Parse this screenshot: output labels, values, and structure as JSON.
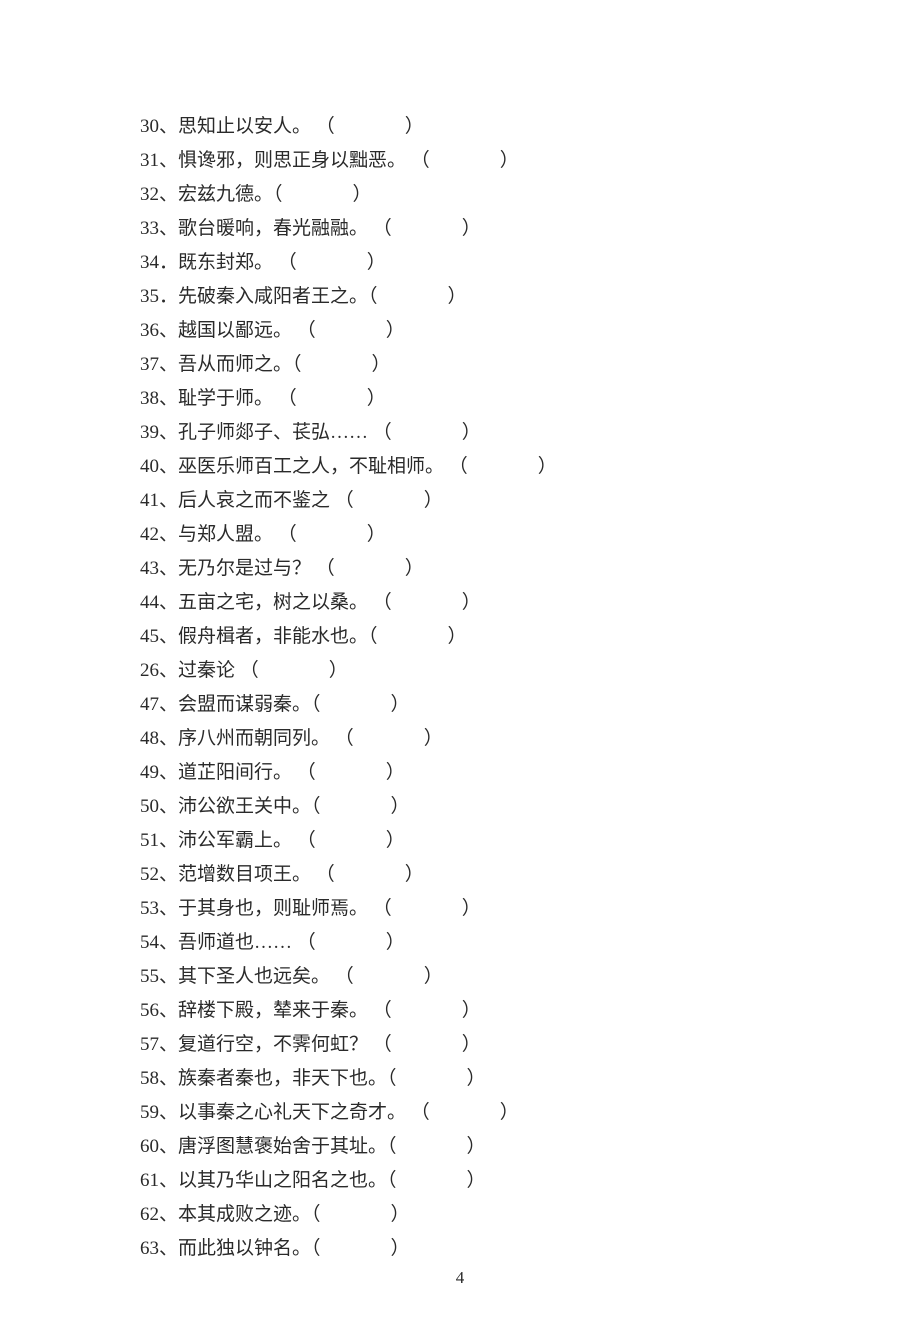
{
  "page_number": "4",
  "blank": "　　　",
  "items": [
    {
      "num": "30",
      "sep": "、",
      "text": "思知止以安人。",
      "pad": " "
    },
    {
      "num": "31",
      "sep": "、",
      "text": "惧谗邪，则思正身以黜恶。",
      "pad": " "
    },
    {
      "num": "32",
      "sep": "、",
      "text": "宏兹九德。",
      "pad": ""
    },
    {
      "num": "33",
      "sep": "、",
      "text": "歌台暖响，春光融融。",
      "pad": " "
    },
    {
      "num": "34",
      "sep": "．",
      "text": "既东封郑。",
      "pad": " "
    },
    {
      "num": "35",
      "sep": "．",
      "text": "先破秦入咸阳者王之。",
      "pad": ""
    },
    {
      "num": "36",
      "sep": "、",
      "text": "越国以鄙远。",
      "pad": " "
    },
    {
      "num": "37",
      "sep": "、",
      "text": "吾从而师之。",
      "pad": ""
    },
    {
      "num": "38",
      "sep": "、",
      "text": "耻学于师。",
      "pad": " "
    },
    {
      "num": "39",
      "sep": "、",
      "text": "孔子师郯子、苌弘……",
      "pad": " "
    },
    {
      "num": "40",
      "sep": "、",
      "text": "巫医乐师百工之人，不耻相师。",
      "pad": " "
    },
    {
      "num": "41",
      "sep": "、",
      "text": "后人哀之而不鉴之",
      "pad": " "
    },
    {
      "num": "42",
      "sep": "、",
      "text": "与郑人盟。",
      "pad": " "
    },
    {
      "num": "43",
      "sep": "、",
      "text": "无乃尔是过与？",
      "pad": " "
    },
    {
      "num": "44",
      "sep": "、",
      "text": "五亩之宅，树之以桑。",
      "pad": " "
    },
    {
      "num": "45",
      "sep": "、",
      "text": "假舟楫者，非能水也。",
      "pad": ""
    },
    {
      "num": "26",
      "sep": "、",
      "text": "过秦论",
      "pad": " "
    },
    {
      "num": "47",
      "sep": "、",
      "text": "会盟而谋弱秦。",
      "pad": ""
    },
    {
      "num": "48",
      "sep": "、",
      "text": "序八州而朝同列。",
      "pad": " "
    },
    {
      "num": "49",
      "sep": "、",
      "text": "道芷阳间行。",
      "pad": " "
    },
    {
      "num": "50",
      "sep": "、",
      "text": "沛公欲王关中。",
      "pad": ""
    },
    {
      "num": "51",
      "sep": "、",
      "text": "沛公军霸上。",
      "pad": " "
    },
    {
      "num": "52",
      "sep": "、",
      "text": "范增数目项王。",
      "pad": " "
    },
    {
      "num": "53",
      "sep": "、",
      "text": "于其身也，则耻师焉。",
      "pad": " "
    },
    {
      "num": "54",
      "sep": "、",
      "text": "吾师道也……",
      "pad": " "
    },
    {
      "num": "55",
      "sep": "、",
      "text": "其下圣人也远矣。",
      "pad": " "
    },
    {
      "num": "56",
      "sep": "、",
      "text": "辞楼下殿，辇来于秦。",
      "pad": " "
    },
    {
      "num": "57",
      "sep": "、",
      "text": "复道行空，不霁何虹？",
      "pad": " "
    },
    {
      "num": "58",
      "sep": "、",
      "text": "族秦者秦也，非天下也。",
      "pad": ""
    },
    {
      "num": "59",
      "sep": "、",
      "text": "以事秦之心礼天下之奇才。",
      "pad": " "
    },
    {
      "num": "60",
      "sep": "、",
      "text": "唐浮图慧褒始舍于其址。",
      "pad": ""
    },
    {
      "num": "61",
      "sep": "、",
      "text": "以其乃华山之阳名之也。",
      "pad": ""
    },
    {
      "num": "62",
      "sep": "、",
      "text": "本其成败之迹。",
      "pad": ""
    },
    {
      "num": "63",
      "sep": "、",
      "text": "而此独以钟名。",
      "pad": ""
    }
  ]
}
